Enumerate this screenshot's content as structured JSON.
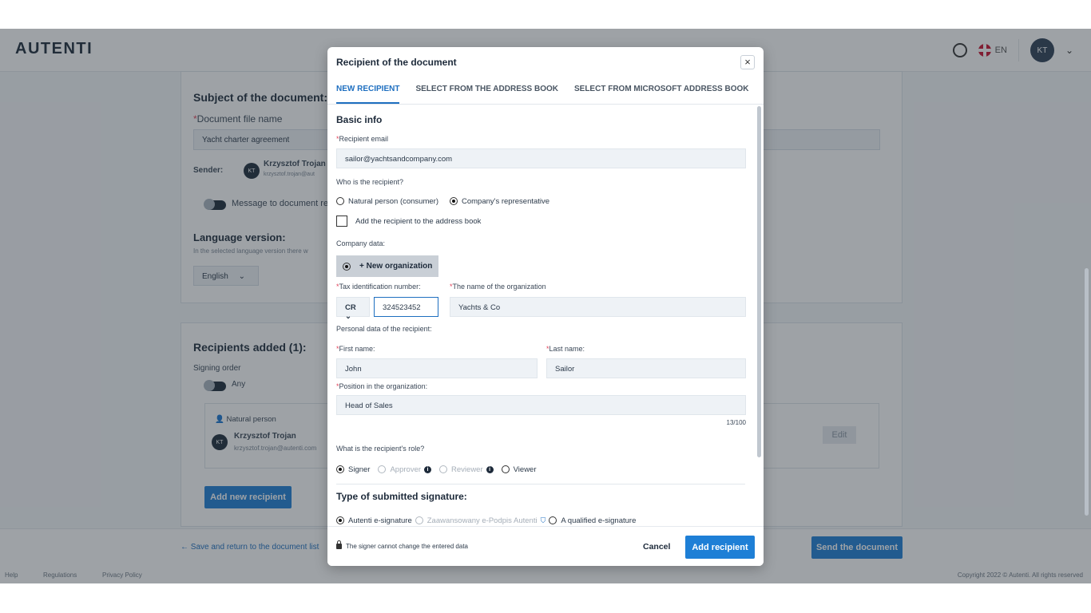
{
  "app": {
    "logo": "AUTENTI",
    "lang": "EN",
    "user_initials": "KT"
  },
  "card1": {
    "subject_title": "Subject of the document:",
    "file_name_label": "Document file name",
    "file_name_value": "Yacht charter agreement",
    "sender_label": "Sender:",
    "sender_initials": "KT",
    "sender_name": "Krzysztof Trojan",
    "sender_email": "krzysztof.trojan@aut",
    "message_label": "Message to document re",
    "language_title": "Language version:",
    "language_hint": "In the selected language version there w",
    "language_value": "English"
  },
  "card2": {
    "title": "Recipients added (1):",
    "signing_order_label": "Signing order",
    "signing_order_value": "Any",
    "recipient_type": "Natural person",
    "recipient_initials": "KT",
    "recipient_name": "Krzysztof Trojan",
    "recipient_email": "krzysztof.trojan@autenti.com",
    "edit_label": "Edit",
    "add_new_label": "Add new recipient"
  },
  "footer": {
    "save_return": "Save and return to the document list",
    "send_label": "Send the document",
    "links": [
      "Help",
      "Regulations",
      "Privacy Policy"
    ],
    "copyright": "Copyright 2022 © Autenti. All rights reserved"
  },
  "modal": {
    "title": "Recipient of the document",
    "tabs": [
      "NEW RECIPIENT",
      "SELECT FROM THE ADDRESS BOOK",
      "SELECT FROM MICROSOFT ADDRESS BOOK"
    ],
    "basic_info": "Basic info",
    "email_label": "Recipient email",
    "email_value": "sailor@yachtsandcompany.com",
    "who_label": "Who is the recipient?",
    "who_options": [
      "Natural person (consumer)",
      "Company's representative"
    ],
    "address_book_label": "Add the recipient to the address book",
    "company_data_label": "Company data:",
    "new_org_label": "+ New organization",
    "tax_label": "Tax identification number:",
    "org_name_label": "The name of the organization",
    "tax_prefix": "CR",
    "tax_value": "324523452",
    "org_name_value": "Yachts & Co",
    "personal_label": "Personal data of the recipient:",
    "first_name_label": "First name:",
    "last_name_label": "Last name:",
    "first_name_value": "John",
    "last_name_value": "Sailor",
    "position_label": "Position in the organization:",
    "position_value": "Head of Sales",
    "position_counter": "13/100",
    "role_label": "What is the recipient's role?",
    "roles": [
      "Signer",
      "Approver",
      "Reviewer",
      "Viewer"
    ],
    "signature_title": "Type of submitted signature:",
    "signatures": [
      "Autenti e-signature",
      "Zaawansowany e-Podpis Autenti",
      "A qualified e-signature"
    ],
    "footer_note": "The signer cannot change the entered data",
    "cancel_label": "Cancel",
    "add_label": "Add recipient"
  },
  "colors": {
    "accent": "#1e7fd6",
    "required": "#e0445b",
    "dark": "#1d2a3a"
  }
}
